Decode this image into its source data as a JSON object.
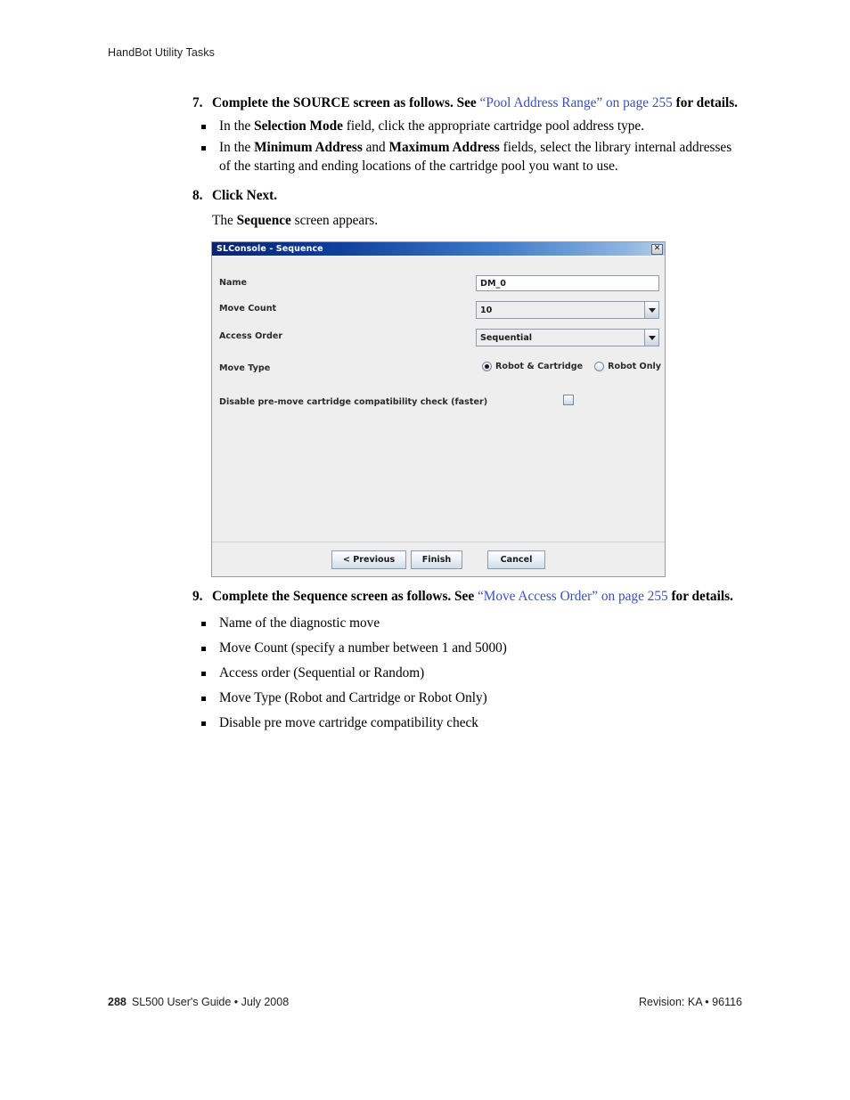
{
  "header": {
    "running_head": "HandBot Utility Tasks"
  },
  "steps": [
    {
      "number": "7.",
      "text_before": "Complete the SOURCE screen as follows. See ",
      "xref": "“Pool Address Range” on page 255",
      "text_after": " for details.",
      "bullets": [
        {
          "segments": [
            {
              "t": "In the ",
              "b": false
            },
            {
              "t": "Selection Mode",
              "b": true
            },
            {
              "t": " field, click the appropriate cartridge pool address type.",
              "b": false
            }
          ]
        },
        {
          "segments": [
            {
              "t": "In the ",
              "b": false
            },
            {
              "t": "Minimum Address",
              "b": true
            },
            {
              "t": " and ",
              "b": false
            },
            {
              "t": "Maximum Address",
              "b": true
            },
            {
              "t": " fields, select the library internal addresses of the starting and ending locations of the cartridge pool you want to use.",
              "b": false
            }
          ]
        }
      ]
    },
    {
      "number": "8.",
      "text_before": "Click Next.",
      "xref": "",
      "text_after": "",
      "bullets": []
    }
  ],
  "after_step8": {
    "prefix": "The ",
    "bold": "Sequence",
    "suffix": " screen appears."
  },
  "step9": {
    "number": "9.",
    "text_before": "Complete the Sequence screen as follows. See ",
    "xref": "“Move Access Order” on page 255",
    "text_after": " for details.",
    "bullets": [
      "Name of the diagnostic move",
      "Move Count (specify a number between 1 and 5000)",
      "Access order (Sequential or Random)",
      "Move Type (Robot and Cartridge or Robot Only)",
      "Disable pre move cartridge compatibility check"
    ]
  },
  "dialog": {
    "title": "SLConsole - Sequence",
    "close_label": "✕",
    "fields": {
      "name_label": "Name",
      "name_value": "DM_0",
      "move_count_label": "Move Count",
      "move_count_value": "10",
      "access_order_label": "Access Order",
      "access_order_value": "Sequential",
      "move_type_label": "Move Type",
      "move_type_option1": "Robot & Cartridge",
      "move_type_option2": "Robot Only",
      "disable_check_label": "Disable pre-move cartridge compatibility check (faster)"
    },
    "buttons": {
      "previous": "< Previous",
      "finish": "Finish",
      "cancel": "Cancel"
    }
  },
  "footer": {
    "page_number": "288",
    "guide": "SL500 User's Guide  •  July 2008",
    "revision": "Revision: KA  •  96116"
  },
  "colors": {
    "xref_blue": "#3a4fc4",
    "titlebar_dark": "#0a246a",
    "titlebar_light": "#b6d0ea",
    "dialog_bg": "#eeeeee"
  }
}
